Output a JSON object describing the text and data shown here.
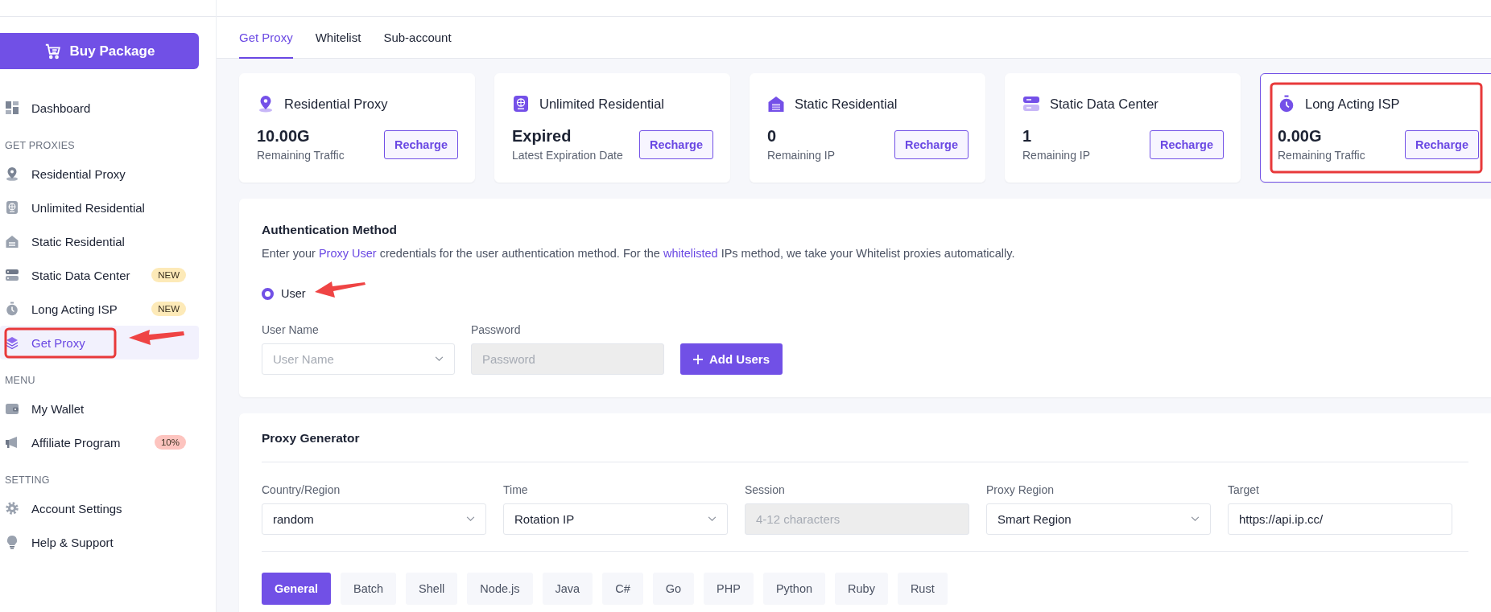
{
  "sidebar": {
    "buy_button": "Buy Package",
    "items": [
      {
        "kind": "item",
        "label": "Dashboard",
        "selected": false
      },
      {
        "kind": "heading",
        "label": "GET PROXIES"
      },
      {
        "kind": "item",
        "label": "Residential Proxy",
        "selected": false
      },
      {
        "kind": "item",
        "label": "Unlimited Residential",
        "selected": false
      },
      {
        "kind": "item",
        "label": "Static Residential",
        "selected": false
      },
      {
        "kind": "item",
        "label": "Static Data Center",
        "selected": false,
        "badge": {
          "text": "NEW",
          "color": "#fdeab8"
        }
      },
      {
        "kind": "item",
        "label": "Long Acting ISP",
        "selected": false,
        "badge": {
          "text": "NEW",
          "color": "#fdeab8"
        }
      },
      {
        "kind": "item",
        "label": "Get Proxy",
        "selected": true
      },
      {
        "kind": "heading",
        "label": "MENU"
      },
      {
        "kind": "item",
        "label": "My Wallet",
        "selected": false
      },
      {
        "kind": "item",
        "label": "Affiliate Program",
        "selected": false,
        "badge": {
          "text": "10%",
          "color": "#fdc4bf"
        }
      },
      {
        "kind": "heading",
        "label": "SETTING"
      },
      {
        "kind": "item",
        "label": "Account Settings",
        "selected": false
      },
      {
        "kind": "item",
        "label": "Help & Support",
        "selected": false
      }
    ]
  },
  "tabs": [
    {
      "label": "Get Proxy",
      "selected": true
    },
    {
      "label": "Whitelist",
      "selected": false
    },
    {
      "label": "Sub-account",
      "selected": false
    }
  ],
  "cards": [
    {
      "title": "Residential Proxy",
      "value": "10.00G",
      "caption": "Remaining Traffic",
      "button": "Recharge",
      "selected": false
    },
    {
      "title": "Unlimited Residential",
      "value": "Expired",
      "caption": "Latest Expiration Date",
      "button": "Recharge",
      "selected": false
    },
    {
      "title": "Static Residential",
      "value": "0",
      "caption": "Remaining IP",
      "button": "Recharge",
      "selected": false
    },
    {
      "title": "Static Data Center",
      "value": "1",
      "caption": "Remaining IP",
      "button": "Recharge",
      "selected": false
    },
    {
      "title": "Long Acting ISP",
      "value": "0.00G",
      "caption": "Remaining Traffic",
      "button": "Recharge",
      "selected": true
    }
  ],
  "authentication": {
    "title": "Authentication Method",
    "description": [
      {
        "kind": "text",
        "text": "Enter your "
      },
      {
        "kind": "link",
        "text": "Proxy User"
      },
      {
        "kind": "text",
        "text": " credentials for the user authentication method. For the "
      },
      {
        "kind": "link",
        "text": "whitelisted"
      },
      {
        "kind": "text",
        "text": " IPs method, we take your Whitelist proxies automatically."
      }
    ],
    "options": [
      {
        "label": "User",
        "selected": true
      }
    ],
    "fields": [
      {
        "label": "User Name",
        "placeholder": "User Name",
        "kind": "select",
        "disabled": false
      },
      {
        "label": "Password",
        "placeholder": "Password",
        "kind": "input",
        "disabled": true
      }
    ],
    "add_button": "Add Users"
  },
  "generator": {
    "title": "Proxy Generator",
    "fields": [
      {
        "label": "Country/Region",
        "value": "random",
        "kind": "select",
        "disabled": false
      },
      {
        "label": "Time",
        "value": "Rotation IP",
        "kind": "select",
        "disabled": false
      },
      {
        "label": "Session",
        "placeholder": "4-12 characters",
        "kind": "input",
        "disabled": true
      },
      {
        "label": "Proxy Region",
        "value": "Smart Region",
        "kind": "select",
        "disabled": false
      },
      {
        "label": "Target",
        "value": "https://api.ip.cc/",
        "kind": "input",
        "disabled": false
      }
    ],
    "languages": [
      {
        "label": "General",
        "selected": true
      },
      {
        "label": "Batch",
        "selected": false
      },
      {
        "label": "Shell",
        "selected": false
      },
      {
        "label": "Node.js",
        "selected": false
      },
      {
        "label": "Java",
        "selected": false
      },
      {
        "label": "C#",
        "selected": false
      },
      {
        "label": "Go",
        "selected": false
      },
      {
        "label": "PHP",
        "selected": false
      },
      {
        "label": "Python",
        "selected": false
      },
      {
        "label": "Ruby",
        "selected": false
      },
      {
        "label": "Rust",
        "selected": false
      }
    ]
  }
}
